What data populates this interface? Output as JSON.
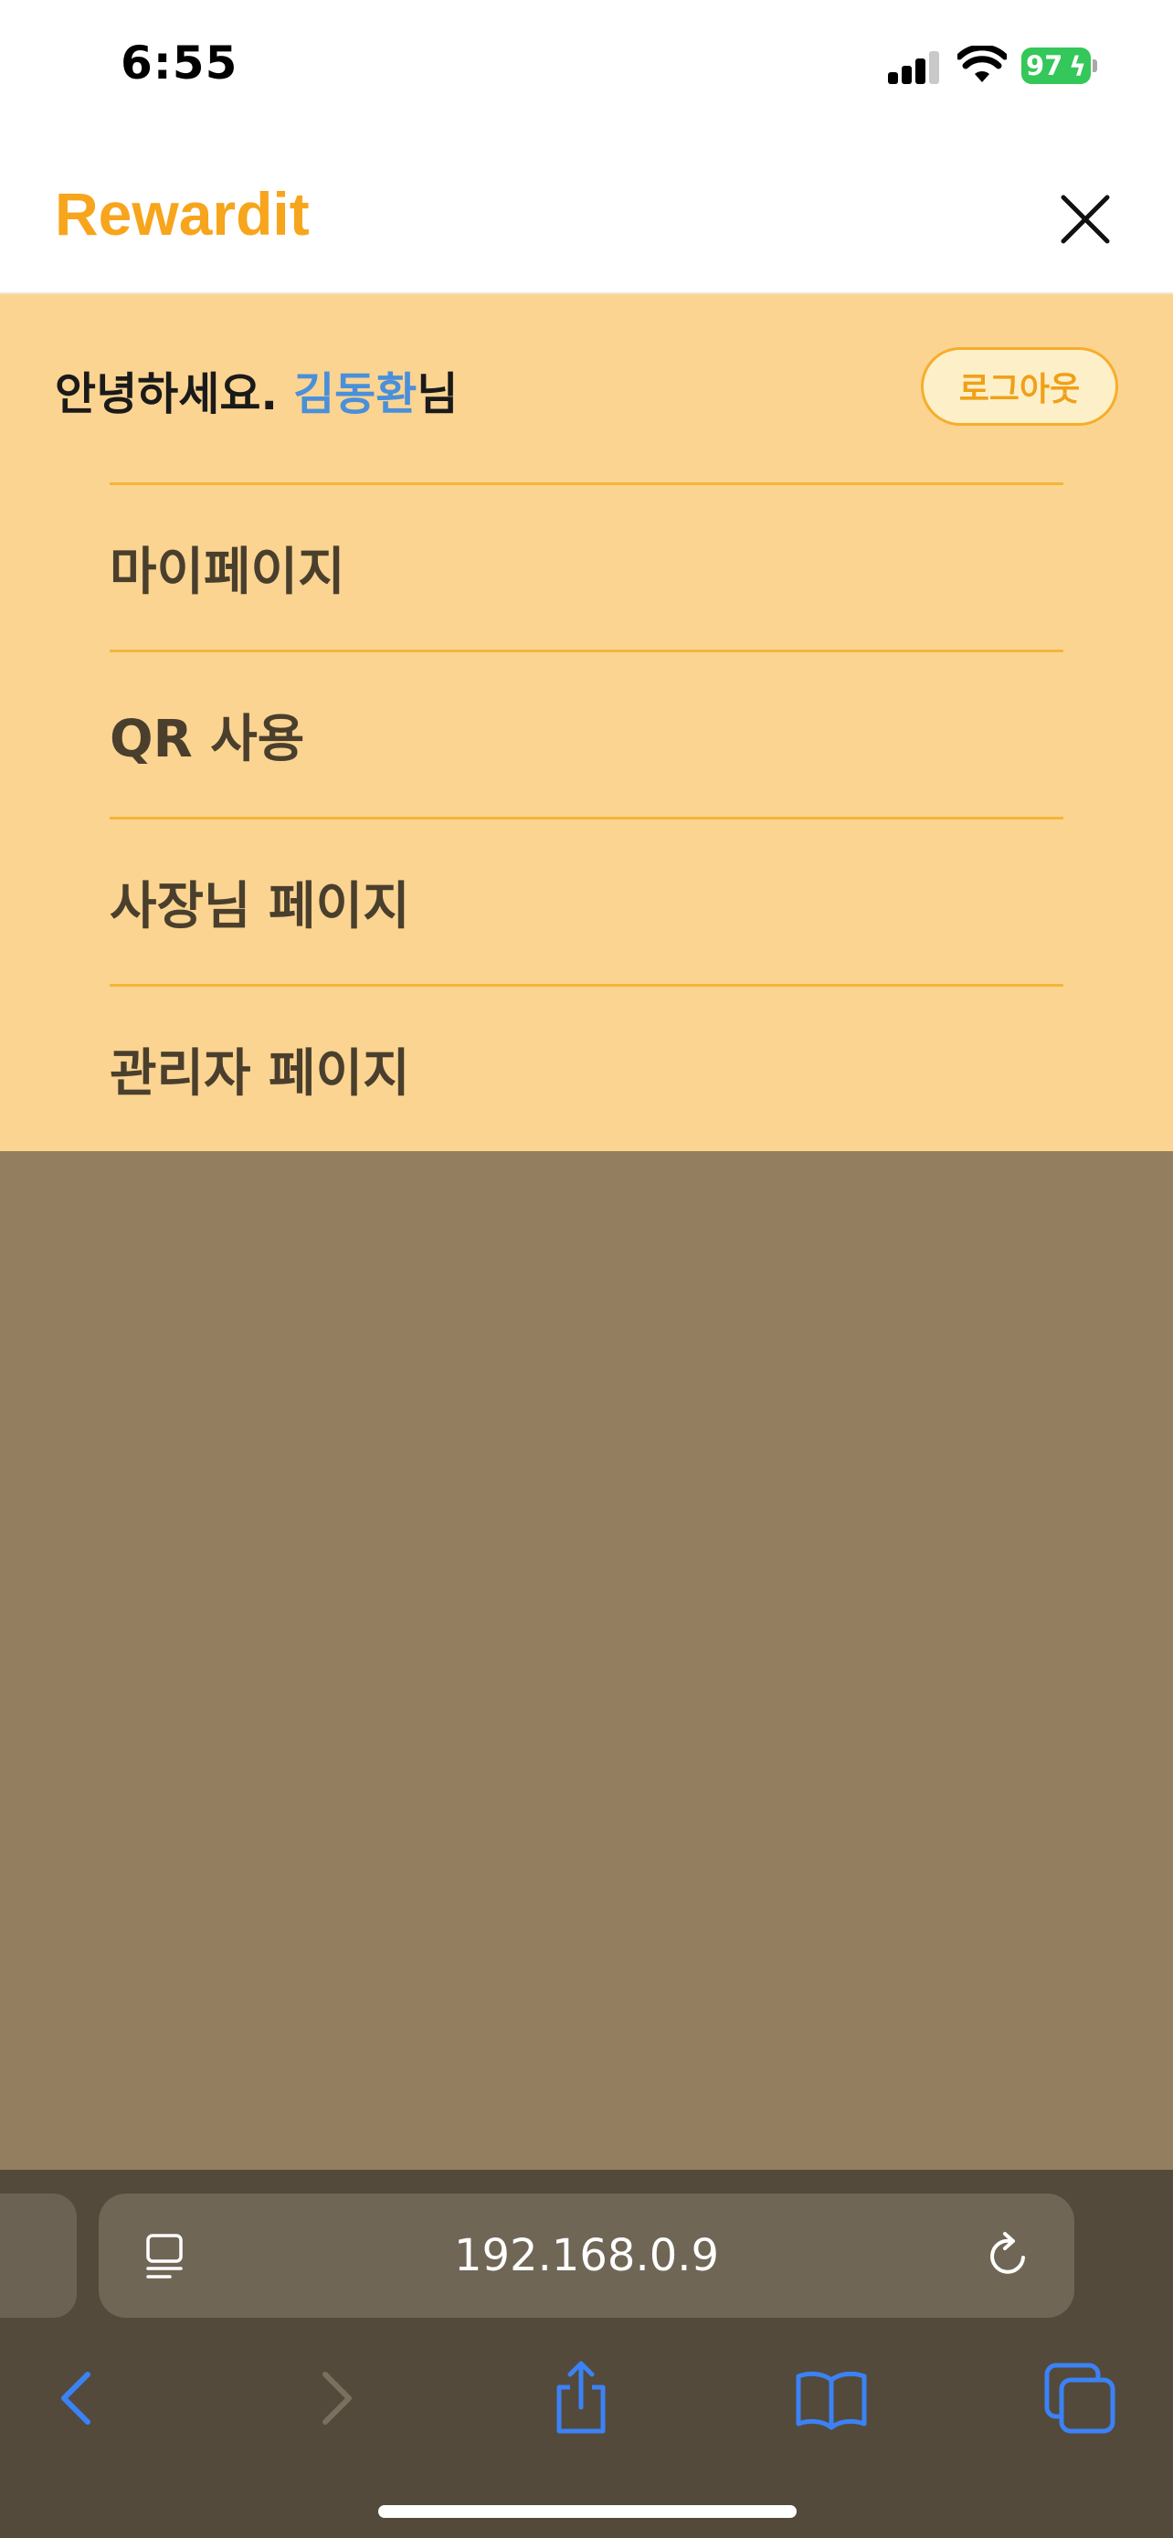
{
  "status_bar": {
    "time": "6:55",
    "battery_percent": "97",
    "battery_color": "#34c759"
  },
  "header": {
    "logo": "Rewardit",
    "logo_color": "#f7a51c",
    "close_icon": "close-icon"
  },
  "menu": {
    "greeting_prefix": "안녕하세요. ",
    "user_name": "김동환",
    "greeting_suffix": "님",
    "logout_label": "로그아웃",
    "panel_color": "#fbd491",
    "items": [
      {
        "label": "마이페이지"
      },
      {
        "label": "QR 사용"
      },
      {
        "label": "사장님 페이지"
      },
      {
        "label": "관리자 페이지"
      }
    ]
  },
  "browser": {
    "url": "192.168.0.9",
    "icons": [
      "reader-icon",
      "reload-icon",
      "back-icon",
      "forward-icon",
      "share-icon",
      "bookmarks-icon",
      "tabs-icon"
    ],
    "accent_color": "#3b82f6"
  }
}
